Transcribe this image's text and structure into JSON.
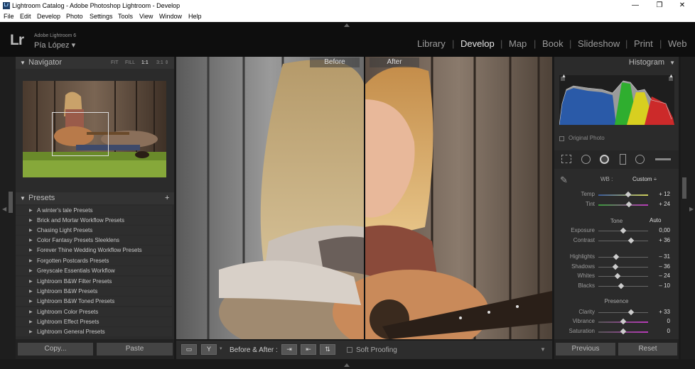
{
  "window": {
    "title": "Lightroom Catalog - Adobe Photoshop Lightroom - Develop",
    "app_icon": "Lr"
  },
  "menu": [
    "File",
    "Edit",
    "Develop",
    "Photo",
    "Settings",
    "Tools",
    "View",
    "Window",
    "Help"
  ],
  "identity": {
    "logo": "Lr",
    "version": "Adobe Lightroom 6",
    "user": "Pía López ▾"
  },
  "modules": [
    "Library",
    "Develop",
    "Map",
    "Book",
    "Slideshow",
    "Print",
    "Web"
  ],
  "navigator": {
    "title": "Navigator",
    "fit": "FIT",
    "fill": "FILL",
    "one": "1:1",
    "three": "3:1 ⇕"
  },
  "presets": {
    "title": "Presets",
    "add": "+",
    "items": [
      "A winter's tale Presets",
      "Brick and Mortar Workflow Presets",
      "Chasing Light Presets",
      "Color Fantasy Presets Sleeklens",
      "Forever Thine Wedding Workflow Presets",
      "Forgotten Postcards Presets",
      "Greyscale Essentials Workflow",
      "Lightroom B&W Filter Presets",
      "Lightroom B&W Presets",
      "Lightroom B&W Toned Presets",
      "Lightroom Color Presets",
      "Lightroom Effect Presets",
      "Lightroom General Presets"
    ]
  },
  "left_buttons": {
    "copy": "Copy...",
    "paste": "Paste"
  },
  "view": {
    "before": "Before",
    "after": "After"
  },
  "toolbar": {
    "ba_label": "Before & After :",
    "soft_proofing": "Soft Proofing",
    "y_label": "Y"
  },
  "histogram": {
    "title": "Histogram",
    "original": "Original Photo"
  },
  "basic": {
    "wb_label": "WB :",
    "wb_value": "Custom ÷",
    "tone_label": "Tone",
    "auto": "Auto",
    "presence_label": "Presence",
    "sliders": [
      {
        "label": "Temp",
        "value": "+ 12",
        "pos": 0.6
      },
      {
        "label": "Tint",
        "value": "+ 24",
        "pos": 0.62
      },
      {
        "label": "Exposure",
        "value": "0,00",
        "pos": 0.5
      },
      {
        "label": "Contrast",
        "value": "+ 36",
        "pos": 0.66
      },
      {
        "label": "Highlights",
        "value": "– 31",
        "pos": 0.36
      },
      {
        "label": "Shadows",
        "value": "– 36",
        "pos": 0.34
      },
      {
        "label": "Whites",
        "value": "– 24",
        "pos": 0.38
      },
      {
        "label": "Blacks",
        "value": "– 10",
        "pos": 0.45
      },
      {
        "label": "Clarity",
        "value": "+ 33",
        "pos": 0.65
      },
      {
        "label": "Vibrance",
        "value": "0",
        "pos": 0.5
      },
      {
        "label": "Saturation",
        "value": "0",
        "pos": 0.5
      }
    ]
  },
  "right_buttons": {
    "previous": "Previous",
    "reset": "Reset"
  },
  "colors": {
    "panel": "#2b2b2b",
    "accent": "#e6e6e6",
    "bg": "#1a1a1a"
  }
}
